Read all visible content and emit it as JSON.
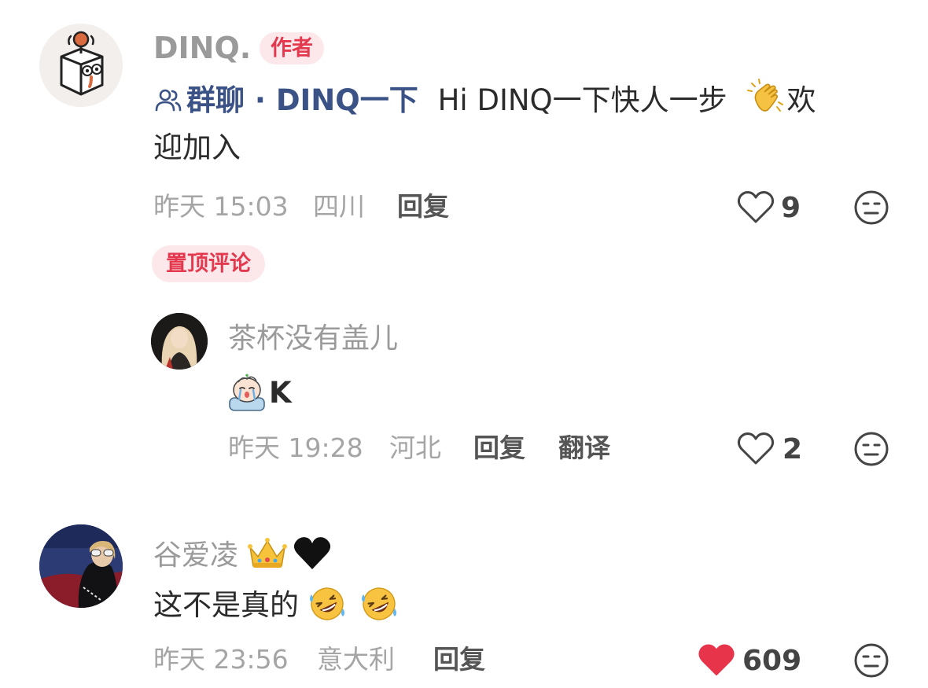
{
  "comments": [
    {
      "username": "DINQ.",
      "badge": "作者",
      "group_link_label": "群聊 · DINQ一下",
      "text_line1": "Hi DINQ一下快人一步",
      "text_line1_tail": "欢",
      "text_line2": "迎加入",
      "time": "昨天 15:03",
      "location": "四川",
      "reply_label": "回复",
      "likes": "9",
      "liked": false,
      "pinned_label": "置顶评论"
    },
    {
      "username": "茶杯没有盖儿",
      "text": "K",
      "time": "昨天 19:28",
      "location": "河北",
      "reply_label": "回复",
      "translate_label": "翻译",
      "likes": "2",
      "liked": false
    },
    {
      "username": "谷爱凌",
      "text": "这不是真的",
      "time": "昨天 23:56",
      "location": "意大利",
      "reply_label": "回复",
      "likes": "609",
      "liked": true
    }
  ],
  "colors": {
    "accent": "#e4384e",
    "link": "#3a5285",
    "badge_bg": "#fce8ea",
    "muted": "#a5a5a5",
    "like_active": "#e8344a"
  },
  "icons": {
    "group": "people-icon",
    "clap": "clapping-hands-emoji",
    "crown": "crown-emoji",
    "black_heart": "black-heart-emoji",
    "laugh": "rolling-on-floor-laughing-emoji",
    "crying_baby": "crying-sticker-emoji",
    "heart_outline": "heart-outline-icon",
    "heart_filled": "heart-filled-icon",
    "dislike": "neutral-face-icon"
  }
}
